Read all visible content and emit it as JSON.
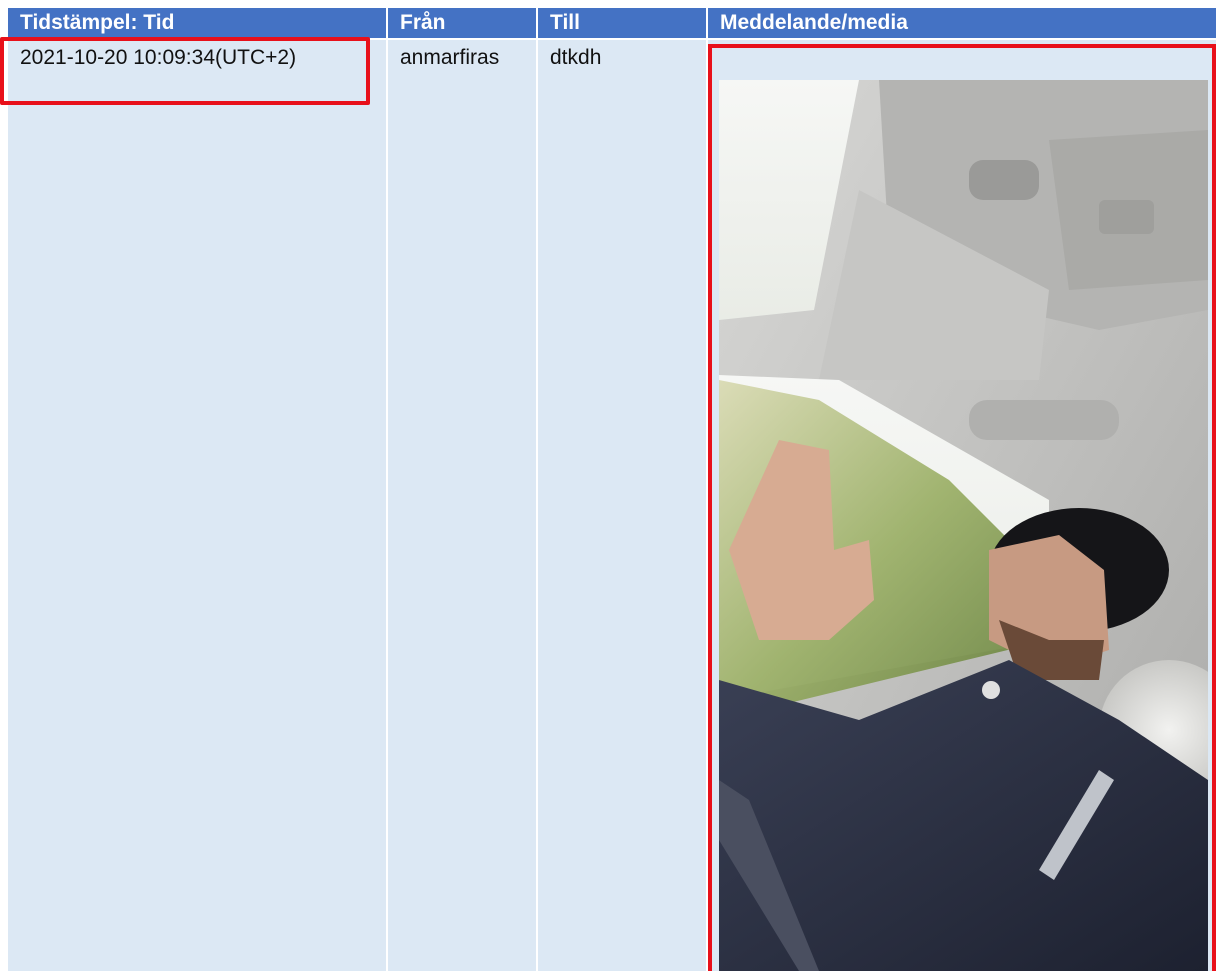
{
  "table": {
    "columns": [
      "Tidstämpel: Tid",
      "Från",
      "Till",
      "Meddelande/media"
    ],
    "rows": [
      {
        "timestamp": "2021-10-20 10:09:34(UTC+2)",
        "from": "anmarfiras",
        "to": "dtkdh"
      }
    ]
  },
  "colors": {
    "header_bg": "#4472c4",
    "row_bg": "#dce8f4",
    "highlight": "#e8101a"
  }
}
